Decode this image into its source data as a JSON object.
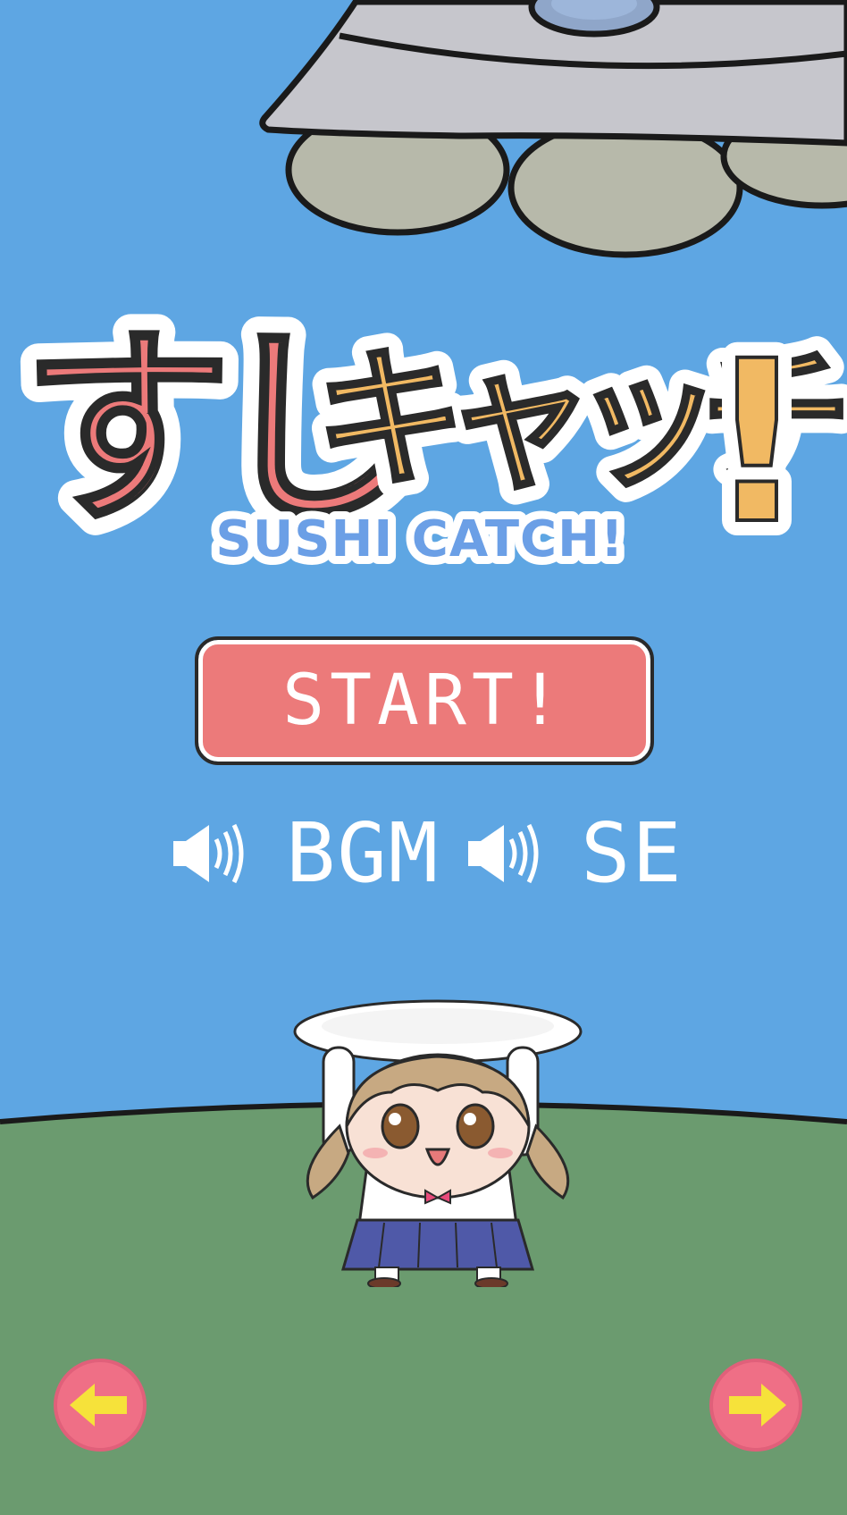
{
  "game": {
    "title_jp_part1": "すし",
    "title_jp_part2": "キャッチ",
    "title_jp_mark": "!",
    "title_en": "SUSHI CATCH!"
  },
  "menu": {
    "start_label": "START!",
    "bgm_label": "BGM",
    "se_label": "SE",
    "bgm_icon": "speaker-on-icon",
    "se_icon": "speaker-on-icon"
  },
  "navigation": {
    "prev_icon": "arrow-left-icon",
    "next_icon": "arrow-right-icon"
  },
  "colors": {
    "sky": "#5ea6e3",
    "ground": "#6b9b6f",
    "accent_pink": "#ec7a7a",
    "accent_yellow": "#f1b963",
    "accent_blue": "#6b9fe6",
    "nav_button": "#ef6f86",
    "nav_arrow": "#f6e23a"
  }
}
